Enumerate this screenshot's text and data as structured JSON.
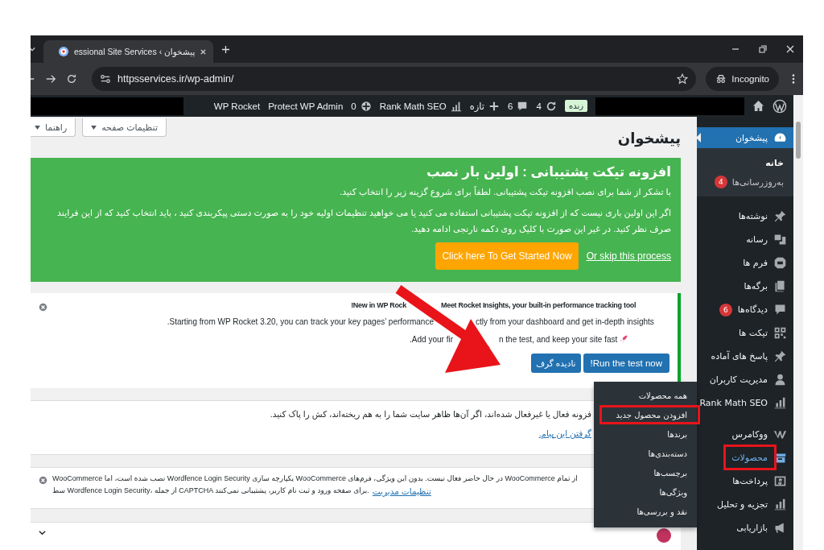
{
  "browser": {
    "tab_title": "essional Site Services ‹ پیشخوان",
    "url": "httpsservices.ir/wp-admin/",
    "incognito_label": "Incognito"
  },
  "admin_bar": {
    "rocket_label": "WP Rocket",
    "protect_label": "Protect WP Admin",
    "security_count": "0",
    "seo_label": "Rank Math SEO",
    "new_label": "تازه",
    "comments_count": "6",
    "updates_count": "4",
    "live_badge": "زنده"
  },
  "screen_buttons": [
    "تنظیمات صفحه",
    "راهنما"
  ],
  "page_title": "پیشخوان",
  "setup_notice": {
    "title": "افزونه تیکت پشتیبانی : اولین بار نصب",
    "paragraphs": [
      "با تشکر از شما برای نصب افزونه تیکت پشتیبانی. لطفاً برای شروع گزینه زیر را انتخاب کنید.",
      "اگر این اولین باری نیست که از افزونه تیکت پشتیبانی استفاده می کنید یا می خواهید تنظیمات اولیه خود را به صورت دستی پیکربندی کنید ، باید انتخاب کنید که از این فرایند صرف نظر کنید. در غیر این صورت با کلیک روی دکمه نارنجی ادامه دهید."
    ],
    "skip_link": "Or skip this process",
    "start_button": "Click here To Get Started Now"
  },
  "rocket_notice": {
    "lines": [
      [
        "Meet Rocket Insights, your built-in performance tracking tool",
        "!New in WP Rock"
      ],
      [
        "ctly from your dashboard and get in-depth insights",
        ".Starting from WP Rocket 3.20, you can track your key pages’ performance"
      ],
      [
        "n the test, and keep your site fast",
        ".Add your fir"
      ]
    ],
    "buttons": [
      "!Run the test now",
      "نادیده گرف"
    ]
  },
  "cache_notice": {
    "text": "فزونه فعال یا غیرفعال شده‌اند، اگر آن‌ها ظاهر سایت شما را به هم ریخته‌اند، کش را پاک کنید.",
    "link": "گرفتن این پیام."
  },
  "wordfence_notice": {
    "lines": [
      "WooCommerce نصب شده است، اما Wordfence Login Security یکپارچه سازی WooCommerce در حال حاضر فعال نیست. بدون این ویژگی، فرم‌های WooCommerce از تمام",
      "سط Wordfence Login Security، از جمله CAPTCHA برای صفحه ورود و ثبت نام کاربر، پشتیبانی نمی‌کنند."
    ],
    "link": "تنظیمات مدیریت"
  },
  "sidebar": {
    "menu_groups": [
      [
        {
          "label": "پیشخوان",
          "selected": true,
          "hovered": false,
          "boxed": false,
          "children": [
            {
              "label": "خانه",
              "selected": true
            },
            {
              "label": "به‌روزرسانی‌ها",
              "selected": false,
              "badge": "4"
            }
          ]
        }
      ],
      [
        {
          "label": "نوشته‌ها",
          "selected": false,
          "hovered": false,
          "boxed": false
        },
        {
          "label": "رسانه",
          "selected": false,
          "hovered": false,
          "boxed": false
        },
        {
          "label": "فرم ها",
          "selected": false,
          "hovered": false,
          "boxed": false
        },
        {
          "label": "برگه‌ها",
          "selected": false,
          "hovered": false,
          "boxed": false
        },
        {
          "label": "دیدگاه‌ها",
          "selected": false,
          "hovered": false,
          "boxed": false,
          "badge": "6"
        },
        {
          "label": "تیکت ها",
          "selected": false,
          "hovered": false,
          "boxed": false
        },
        {
          "label": "پاسخ های آماده",
          "selected": false,
          "hovered": false,
          "boxed": false
        },
        {
          "label": "مدیریت کاربران",
          "selected": false,
          "hovered": false,
          "boxed": false
        },
        {
          "label": "Rank Math SEO",
          "selected": false,
          "hovered": false,
          "boxed": false
        }
      ],
      [
        {
          "label": "ووکامرس",
          "selected": false,
          "hovered": false,
          "boxed": false
        },
        {
          "label": "محصولات",
          "selected": false,
          "hovered": true,
          "boxed": true
        },
        {
          "label": "پرداخت‌ها",
          "selected": false,
          "hovered": false,
          "boxed": false
        },
        {
          "label": "تجزیه و تحلیل",
          "selected": false,
          "hovered": false,
          "boxed": false
        },
        {
          "label": "بازاریابی",
          "selected": false,
          "hovered": false,
          "boxed": false
        }
      ]
    ]
  },
  "submenu_flyout": [
    {
      "label": "همه محصولات",
      "boxed": false
    },
    {
      "label": "افزودن محصول جدید",
      "boxed": true
    },
    {
      "label": "برندها",
      "boxed": false
    },
    {
      "label": "دسته‌بندی‌ها",
      "boxed": false
    },
    {
      "label": "برچسب‌ها",
      "boxed": false
    },
    {
      "label": "ویژگی‌ها",
      "boxed": false
    },
    {
      "label": "نقد و بررسی‌ها",
      "boxed": false
    }
  ]
}
